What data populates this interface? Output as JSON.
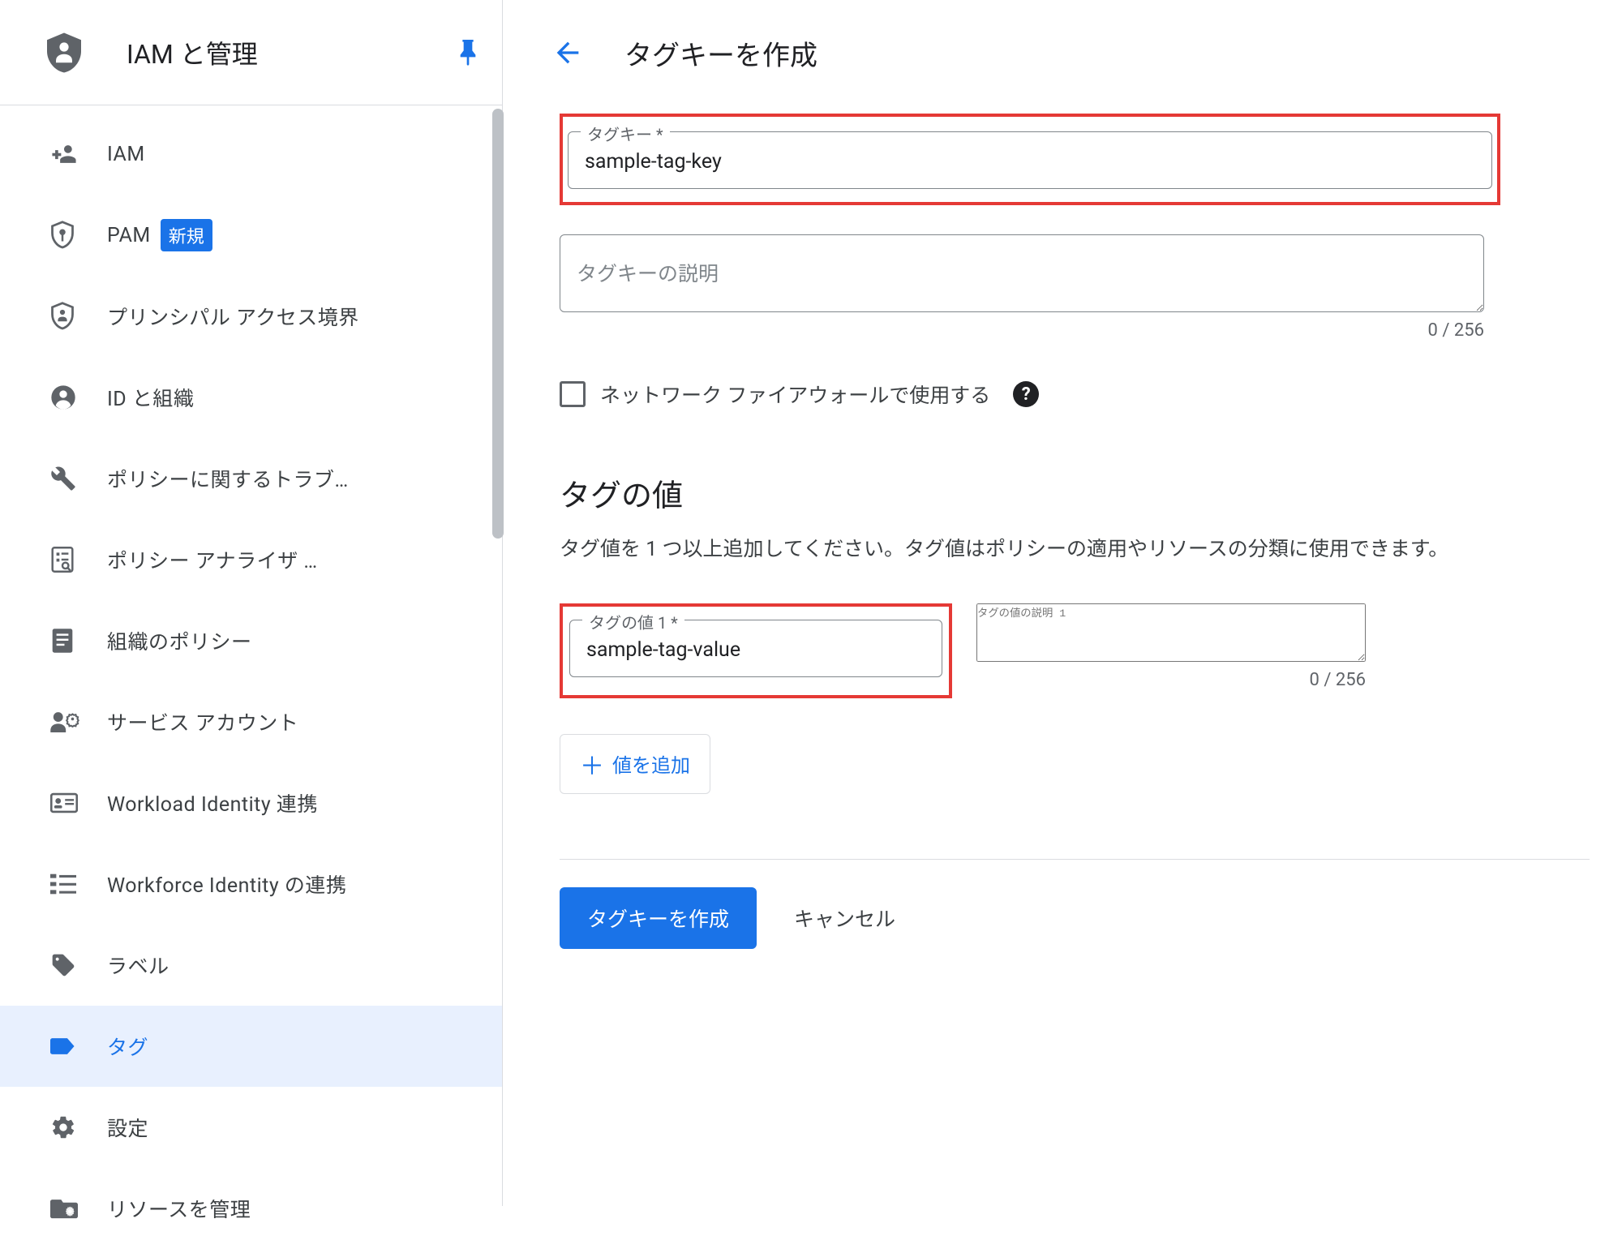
{
  "sidebar": {
    "title": "IAM と管理",
    "items": [
      {
        "label": "IAM",
        "icon": "add-user-icon"
      },
      {
        "label": "PAM",
        "icon": "shield-key-icon",
        "badge": "新規"
      },
      {
        "label": "プリンシパル アクセス境界",
        "icon": "shield-account-icon"
      },
      {
        "label": "ID と組織",
        "icon": "account-circle-icon"
      },
      {
        "label": "ポリシーに関するトラブ…",
        "icon": "wrench-icon"
      },
      {
        "label": "ポリシー アナライザ …",
        "icon": "analyze-icon"
      },
      {
        "label": "組織のポリシー",
        "icon": "article-icon"
      },
      {
        "label": "サービス アカウント",
        "icon": "service-account-icon"
      },
      {
        "label": "Workload Identity 連携",
        "icon": "card-icon"
      },
      {
        "label": "Workforce Identity の連携",
        "icon": "list-icon"
      },
      {
        "label": "ラベル",
        "icon": "tag-icon"
      },
      {
        "label": "タグ",
        "icon": "label-icon"
      },
      {
        "label": "設定",
        "icon": "gear-icon"
      },
      {
        "label": "リソースを管理",
        "icon": "folder-settings-icon"
      }
    ]
  },
  "main": {
    "header_title": "タグキーを作成",
    "tag_key": {
      "label": "タグキー *",
      "value": "sample-tag-key"
    },
    "tag_key_desc": {
      "placeholder": "タグキーの説明",
      "count": "0 / 256"
    },
    "firewall_checkbox": "ネットワーク ファイアウォールで使用する",
    "values_section": {
      "title": "タグの値",
      "description": "タグ値を 1 つ以上追加してください。タグ値はポリシーの適用やリソースの分類に使用できます。"
    },
    "tag_value_1": {
      "label": "タグの値 1 *",
      "value": "sample-tag-value",
      "desc_placeholder": "タグの値の説明 1",
      "count": "0 / 256"
    },
    "add_value_label": "値を追加",
    "footer": {
      "submit": "タグキーを作成",
      "cancel": "キャンセル"
    }
  }
}
